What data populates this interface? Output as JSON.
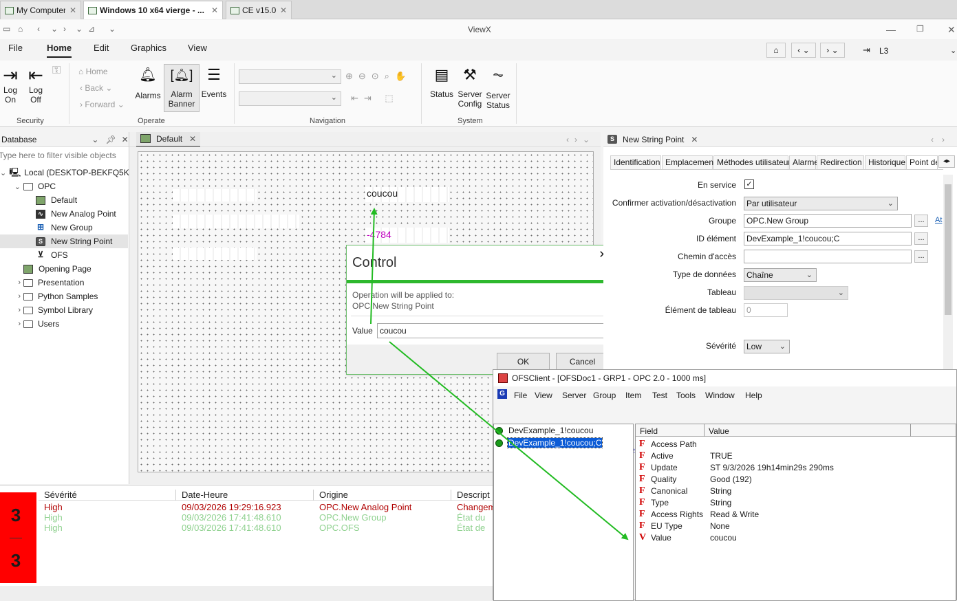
{
  "browser_tabs": [
    {
      "label": "My Computer"
    },
    {
      "label": "Windows 10 x64 vierge - ..."
    },
    {
      "label": "CE v15.0"
    }
  ],
  "app_title": "ViewX",
  "menus": [
    "File",
    "Home",
    "Edit",
    "Graphics",
    "View"
  ],
  "right_nav": {
    "location": "L3"
  },
  "ribbon": {
    "log_on": "Log\nOn",
    "log_off": "Log\nOff",
    "home": "Home",
    "back": "Back",
    "forward": "Forward",
    "alarms": "Alarms",
    "alarm_banner": "Alarm\nBanner",
    "events": "Events",
    "status": "Status",
    "server_config": "Server\nConfig",
    "server_status": "Server\nStatus",
    "groups": {
      "security": "Security",
      "operate": "Operate",
      "navigation": "Navigation",
      "system": "System"
    }
  },
  "database": {
    "title": "Database",
    "filter_placeholder": "Type here to filter visible objects",
    "tree": [
      {
        "label": "Local (DESKTOP-BEKFQ5K)",
        "indent": 0,
        "icon": "computer"
      },
      {
        "label": "OPC",
        "indent": 1,
        "icon": "folder"
      },
      {
        "label": "Default",
        "indent": 2,
        "icon": "mimic"
      },
      {
        "label": "New Analog Point",
        "indent": 2,
        "icon": "analog"
      },
      {
        "label": "New Group",
        "indent": 2,
        "icon": "group"
      },
      {
        "label": "New String Point",
        "indent": 2,
        "icon": "string"
      },
      {
        "label": "OFS",
        "indent": 2,
        "icon": "ofs"
      },
      {
        "label": "Opening Page",
        "indent": 1,
        "icon": "mimic"
      },
      {
        "label": "Presentation",
        "indent": 1,
        "icon": "folder"
      },
      {
        "label": "Python Samples",
        "indent": 1,
        "icon": "folder"
      },
      {
        "label": "Symbol Library",
        "indent": 1,
        "icon": "folder"
      },
      {
        "label": "Users",
        "indent": 1,
        "icon": "folder"
      }
    ]
  },
  "mimic": {
    "tab": "Default",
    "text_value": "coucou",
    "numeric_value": "-4784"
  },
  "dialog": {
    "title": "Control",
    "applied_to_label": "Operation will be applied to:",
    "applied_to": "OPC.New String Point",
    "value_label": "Value",
    "value": "coucou",
    "ok": "OK",
    "cancel": "Cancel"
  },
  "properties": {
    "tab": "New String Point",
    "tabs": [
      "Identification",
      "Emplacement",
      "Méthodes utilisateur",
      "Alarme",
      "Redirection",
      "Historique",
      "Point de"
    ],
    "en_service": "En service",
    "confirm_label": "Confirmer activation/désactivation",
    "confirm_value": "Par utilisateur",
    "groupe_label": "Groupe",
    "groupe_value": "OPC.New Group",
    "groupe_link": "At",
    "id_label": "ID élément",
    "id_value": "DevExample_1!coucou;C",
    "chemin_label": "Chemin d'accès",
    "chemin_value": "",
    "type_label": "Type de données",
    "type_value": "Chaîne",
    "tableau_label": "Tableau",
    "tableau_value": "",
    "element_label": "Élément de tableau",
    "element_value": "0",
    "severite_label": "Sévérité",
    "severite_value": "Low"
  },
  "alarm_list": {
    "count_top": "3",
    "count_bottom": "3",
    "columns": [
      "Sévérité",
      "Date-Heure",
      "Origine",
      "Descript"
    ],
    "rows": [
      {
        "severity": "High",
        "date": "09/03/2026 19:29:16.923",
        "origin": "OPC.New Analog Point",
        "desc": "Changem",
        "color": "#b00000"
      },
      {
        "severity": "High",
        "date": "09/03/2026 17:41:48.610",
        "origin": "OPC.New Group",
        "desc": "État du",
        "color": "#8fd18f"
      },
      {
        "severity": "High",
        "date": "09/03/2026 17:41:48.610",
        "origin": "OPC.OFS",
        "desc": "État de",
        "color": "#8fd18f"
      }
    ]
  },
  "ofs_client": {
    "title": "OFSClient - [OFSDoc1 - GRP1 - OPC 2.0 - 1000 ms]",
    "menus": [
      "File",
      "View",
      "Server",
      "Group",
      "Item",
      "Test",
      "Tools",
      "Window",
      "Help"
    ],
    "items": [
      "DevExample_1!coucou",
      "DevExample_1!coucou;C"
    ],
    "columns": [
      "Field",
      "Value"
    ],
    "fields": [
      {
        "field": "Access Path",
        "value": ""
      },
      {
        "field": "Active",
        "value": "TRUE"
      },
      {
        "field": "Update",
        "value": "ST 9/3/2026 19h14min29s 290ms"
      },
      {
        "field": "Quality",
        "value": "Good (192)"
      },
      {
        "field": "Canonical",
        "value": "String"
      },
      {
        "field": "Type",
        "value": "String"
      },
      {
        "field": "Access Rights",
        "value": "Read & Write"
      },
      {
        "field": "EU Type",
        "value": "None"
      },
      {
        "field": "Value",
        "value": "coucou"
      }
    ]
  },
  "colors": {
    "accent_green": "#22bb22",
    "alarm_red": "#ff0000",
    "high_red": "#b00000",
    "field_red": "#d00000",
    "mimic_magenta": "#c000c0"
  }
}
